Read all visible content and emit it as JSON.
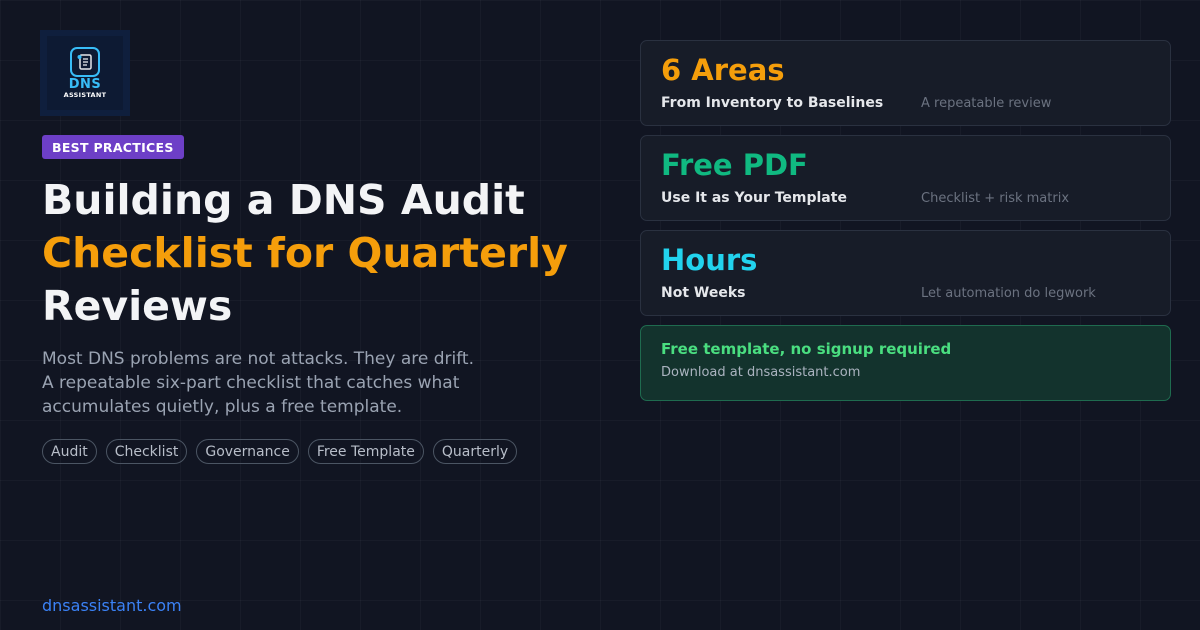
{
  "logo": {
    "word": "DNS",
    "sub": "ASSISTANT"
  },
  "category": "BEST PRACTICES",
  "title": {
    "line1": "Building a DNS Audit",
    "line2": "Checklist for Quarterly",
    "line3": "Reviews"
  },
  "description": {
    "line1": "Most DNS problems are not attacks. They are drift.",
    "line2": "A repeatable six-part checklist that catches what",
    "line3": "accumulates quietly, plus a free template."
  },
  "tags": [
    "Audit",
    "Checklist",
    "Governance",
    "Free Template",
    "Quarterly"
  ],
  "stats": [
    {
      "big": "6 Areas",
      "label": "From Inventory to Baselines",
      "note": "A repeatable review",
      "color": "#f59e0b"
    },
    {
      "big": "Free PDF",
      "label": "Use It as Your Template",
      "note": "Checklist + risk matrix",
      "color": "#10b981"
    },
    {
      "big": "Hours",
      "label": "Not Weeks",
      "note": "Let automation do legwork",
      "color": "#22d3ee"
    }
  ],
  "cta": {
    "title": "Free template, no signup required",
    "subtitle": "Download at dnsassistant.com"
  },
  "footer": {
    "site": "dnsassistant.com"
  }
}
